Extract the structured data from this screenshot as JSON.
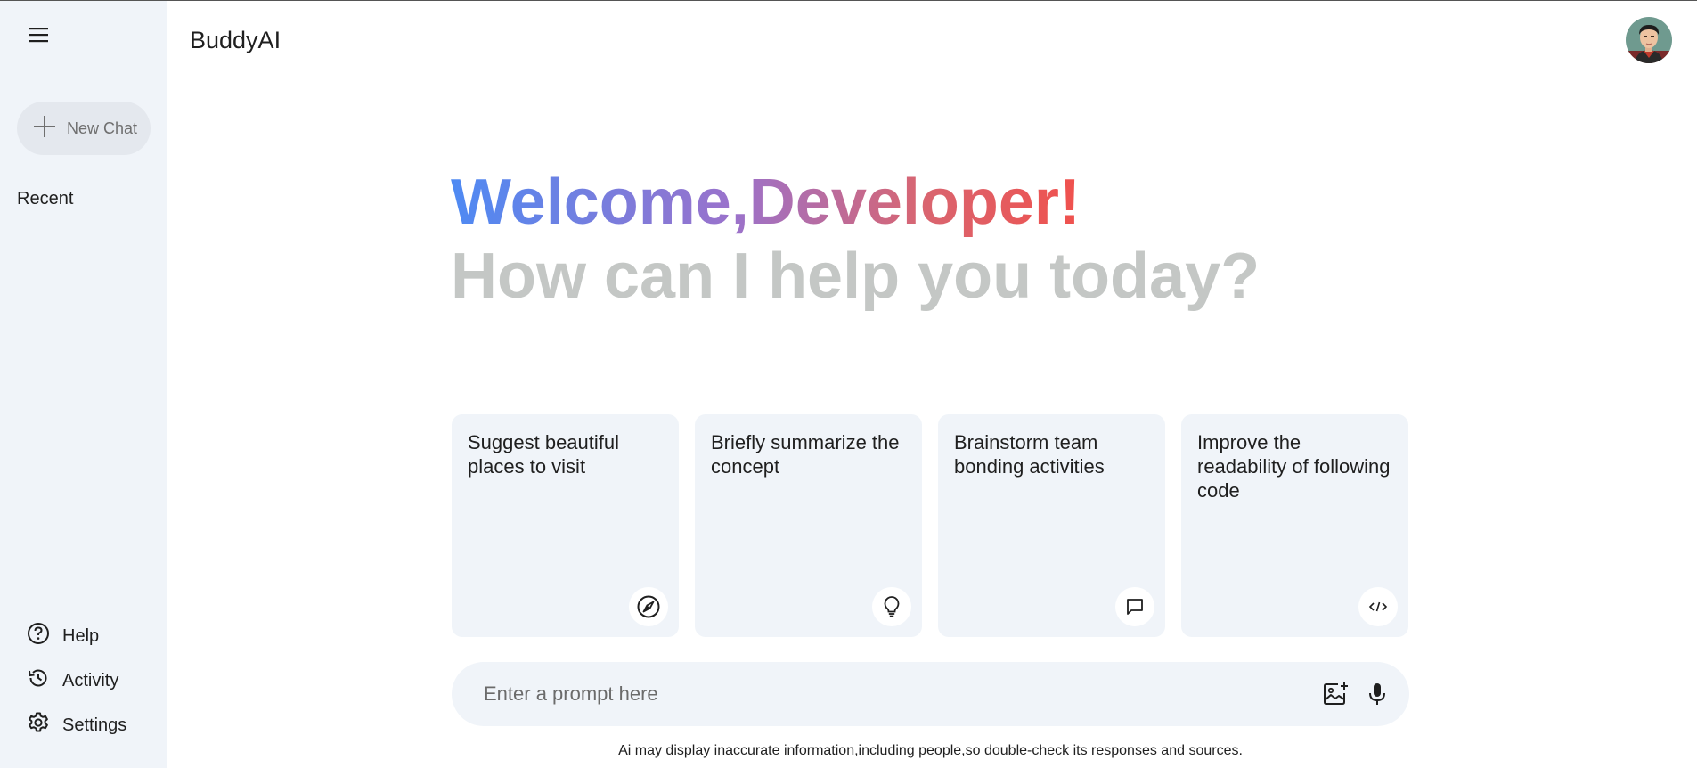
{
  "app": {
    "title": "BuddyAI"
  },
  "sidebar": {
    "new_chat_label": "New Chat",
    "recent_label": "Recent",
    "bottom_items": [
      {
        "label": "Help",
        "icon": "help-icon"
      },
      {
        "label": "Activity",
        "icon": "history-icon"
      },
      {
        "label": "Settings",
        "icon": "gear-icon"
      }
    ]
  },
  "greeting": {
    "line1": "Welcome,Developer!",
    "line2": "How can I help you today?"
  },
  "cards": [
    {
      "text": "Suggest beautiful places to visit",
      "icon": "compass-icon"
    },
    {
      "text": "Briefly summarize the concept",
      "icon": "lightbulb-icon"
    },
    {
      "text": "Brainstorm team bonding activities",
      "icon": "chat-bubble-icon"
    },
    {
      "text": "Improve the readability of following code",
      "icon": "code-icon"
    }
  ],
  "prompt": {
    "placeholder": "Enter a prompt here",
    "icons": [
      "add-image-icon",
      "microphone-icon"
    ]
  },
  "disclaimer": "Ai may display inaccurate information,including people,so double-check its responses and sources.",
  "colors": {
    "sidebar_bg": "#f0f4f9",
    "gradient_start": "#4e8af3",
    "gradient_mid": "#9b72cb",
    "gradient_end": "#f0514d",
    "subtitle_gray": "#c4c7c5"
  }
}
